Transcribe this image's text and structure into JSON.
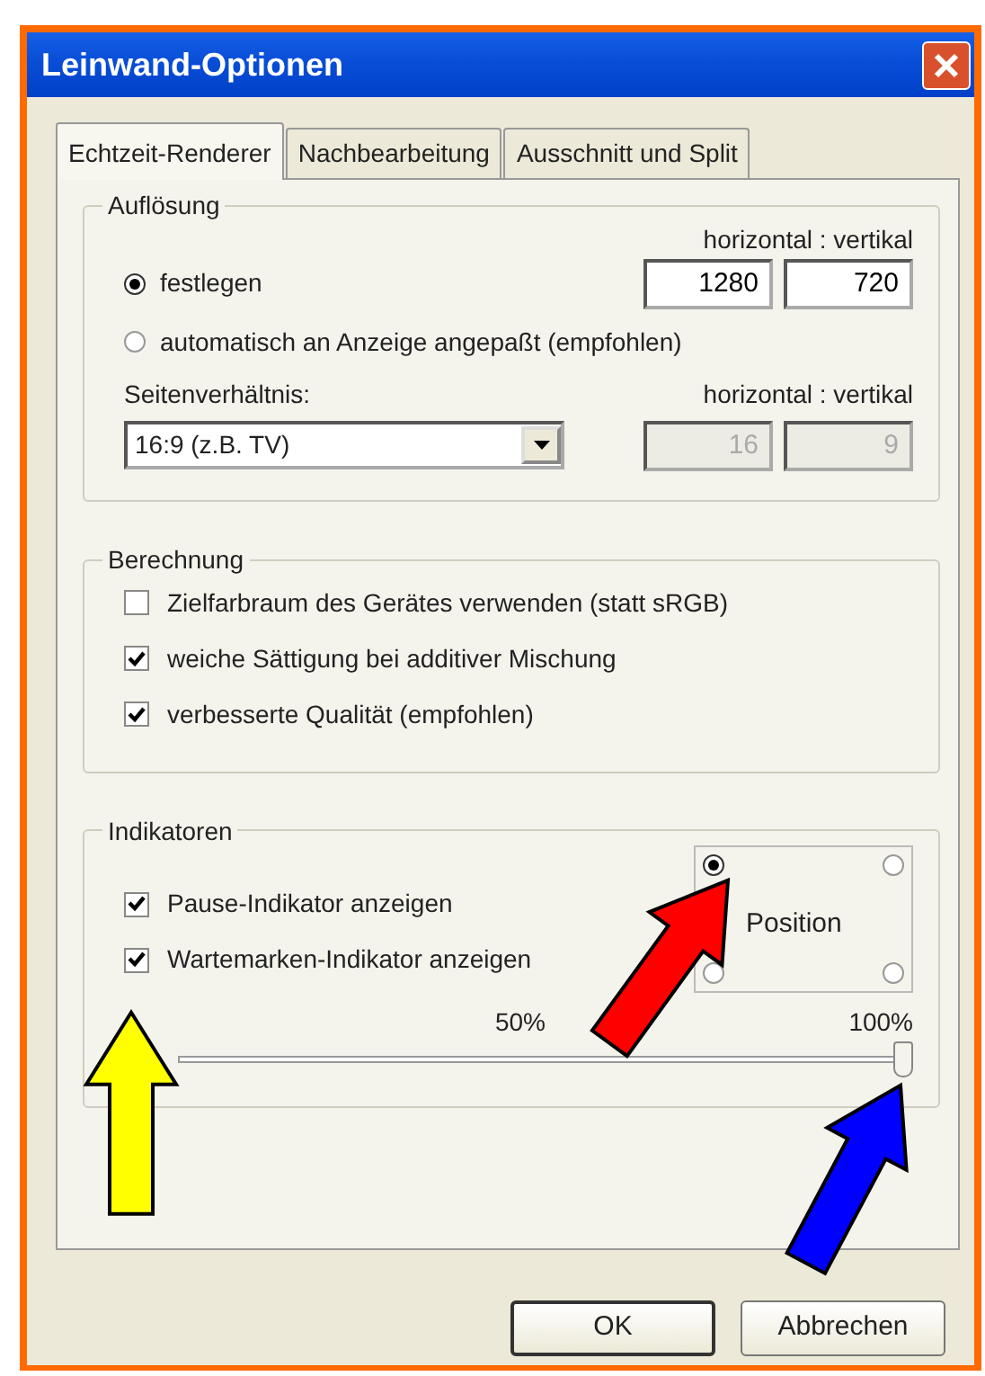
{
  "window": {
    "title": "Leinwand-Optionen"
  },
  "tabs": [
    {
      "label": "Echtzeit-Renderer",
      "selected": true
    },
    {
      "label": "Nachbearbeitung",
      "selected": false
    },
    {
      "label": "Ausschnitt und Split",
      "selected": false
    }
  ],
  "resolution": {
    "title": "Auflösung",
    "size_header": "horizontal : vertikal",
    "modes": [
      {
        "label": "festlegen",
        "selected": true
      },
      {
        "label": "automatisch an Anzeige angepaßt (empfohlen)",
        "selected": false
      }
    ],
    "width": {
      "value": "1280",
      "disabled": false
    },
    "height": {
      "value": "720",
      "disabled": false
    },
    "aspect_label": "Seitenverhältnis:",
    "aspect_header": "horizontal : vertikal",
    "aspect": {
      "value": "16:9 (z.B. TV)"
    },
    "aspect_width": {
      "value": "16",
      "disabled": true
    },
    "aspect_height": {
      "value": "9",
      "disabled": true
    }
  },
  "calculation": {
    "title": "Berechnung",
    "options": [
      {
        "label": "Zielfarbraum des Gerätes verwenden (statt sRGB)",
        "checked": false
      },
      {
        "label": "weiche Sättigung bei additiver Mischung",
        "checked": true
      },
      {
        "label": "verbesserte Qualität (empfohlen)",
        "checked": true
      }
    ]
  },
  "indicators": {
    "title": "Indikatoren",
    "options": [
      {
        "label": "Pause-Indikator anzeigen",
        "checked": true
      },
      {
        "label": "Wartemarken-Indikator anzeigen",
        "checked": true
      }
    ],
    "position": {
      "label": "Position",
      "corners": [
        {
          "selected": true
        },
        {
          "selected": false
        },
        {
          "selected": false
        },
        {
          "selected": false
        }
      ]
    },
    "size": {
      "ticks": [
        "50%",
        "100%"
      ],
      "level": 1
    }
  },
  "buttons": [
    {
      "label": "OK",
      "default": true
    },
    {
      "label": "Abbrechen",
      "default": false
    }
  ],
  "annotations": [
    {
      "kind": "checkbox",
      "color": "#ffff00"
    },
    {
      "kind": "radio",
      "color": "#ff0000"
    },
    {
      "kind": "slider",
      "color": "#0000ff"
    }
  ]
}
